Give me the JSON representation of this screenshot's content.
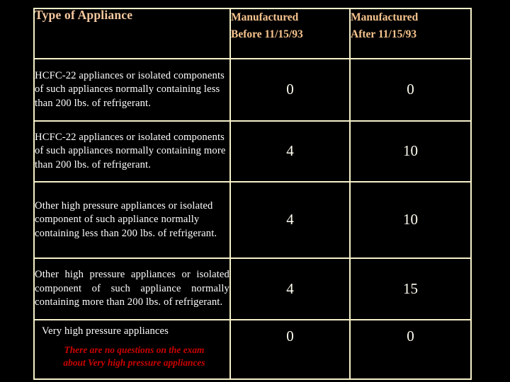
{
  "slide": {
    "background_color": "#000000",
    "border_color": "#f5f0c8",
    "header_text_color": "#f8c48e",
    "body_text_color": "#ffffff",
    "note_text_color": "#cc0000"
  },
  "table": {
    "columns": [
      {
        "key": "type",
        "label": "Type of Appliance"
      },
      {
        "key": "before",
        "label_line1": "Manufactured",
        "label_line2": "Before 11/15/93"
      },
      {
        "key": "after",
        "label_line1": "Manufactured",
        "label_line2": "After 11/15/93"
      }
    ],
    "rows": [
      {
        "description": "HCFC-22 appliances or isolated components of such appliances normally containing less than 200 lbs. of refrigerant.",
        "before": "0",
        "after": "0"
      },
      {
        "description": "HCFC-22 appliances or isolated components of such appliances normally containing more than 200 lbs. of refrigerant.",
        "before": "4",
        "after": "10"
      },
      {
        "description": "Other high pressure appliances or isolated component of such appliance normally containing less than 200 lbs. of refrigerant.",
        "before": "4",
        "after": "10"
      },
      {
        "description": "Other high pressure appliances or isolated component of such appliance normally containing more than 200 lbs. of refrigerant.",
        "before": "4",
        "after": "15"
      },
      {
        "description": "Very high pressure appliances",
        "note_line1": "There are no questions on the exam",
        "note_line2": "about Very high pressure appliances",
        "before": "0",
        "after": "0"
      }
    ]
  }
}
